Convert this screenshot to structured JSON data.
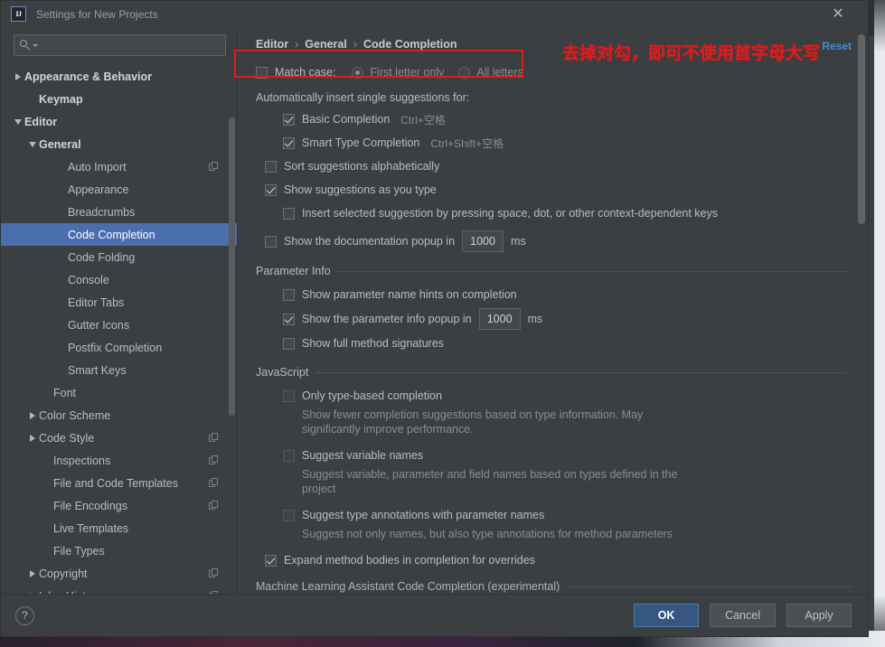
{
  "window": {
    "title": "Settings for New Projects",
    "logo_icon": "intellij-idea-logo",
    "close_icon": "close-icon"
  },
  "search": {
    "value": "",
    "placeholder": "",
    "icon": "search-icon",
    "caret_icon": "chevron-down-icon"
  },
  "sidebar": {
    "scrollbar_icon": "vertical-scrollbar",
    "items": [
      {
        "label": "Appearance & Behavior",
        "indent": 0,
        "twisty": "right",
        "bold": true,
        "selected": false,
        "copy_icon": false
      },
      {
        "label": "Keymap",
        "indent": 1,
        "twisty": "none",
        "bold": true,
        "selected": false,
        "copy_icon": false
      },
      {
        "label": "Editor",
        "indent": 0,
        "twisty": "down",
        "bold": true,
        "selected": false,
        "copy_icon": false
      },
      {
        "label": "General",
        "indent": 1,
        "twisty": "down",
        "bold": true,
        "selected": false,
        "copy_icon": false
      },
      {
        "label": "Auto Import",
        "indent": 3,
        "twisty": "none",
        "bold": false,
        "selected": false,
        "copy_icon": true
      },
      {
        "label": "Appearance",
        "indent": 3,
        "twisty": "none",
        "bold": false,
        "selected": false,
        "copy_icon": false
      },
      {
        "label": "Breadcrumbs",
        "indent": 3,
        "twisty": "none",
        "bold": false,
        "selected": false,
        "copy_icon": false
      },
      {
        "label": "Code Completion",
        "indent": 3,
        "twisty": "none",
        "bold": false,
        "selected": true,
        "copy_icon": false
      },
      {
        "label": "Code Folding",
        "indent": 3,
        "twisty": "none",
        "bold": false,
        "selected": false,
        "copy_icon": false
      },
      {
        "label": "Console",
        "indent": 3,
        "twisty": "none",
        "bold": false,
        "selected": false,
        "copy_icon": false
      },
      {
        "label": "Editor Tabs",
        "indent": 3,
        "twisty": "none",
        "bold": false,
        "selected": false,
        "copy_icon": false
      },
      {
        "label": "Gutter Icons",
        "indent": 3,
        "twisty": "none",
        "bold": false,
        "selected": false,
        "copy_icon": false
      },
      {
        "label": "Postfix Completion",
        "indent": 3,
        "twisty": "none",
        "bold": false,
        "selected": false,
        "copy_icon": false
      },
      {
        "label": "Smart Keys",
        "indent": 3,
        "twisty": "none",
        "bold": false,
        "selected": false,
        "copy_icon": false
      },
      {
        "label": "Font",
        "indent": 2,
        "twisty": "none",
        "bold": false,
        "selected": false,
        "copy_icon": false
      },
      {
        "label": "Color Scheme",
        "indent": 1,
        "twisty": "right",
        "bold": false,
        "selected": false,
        "copy_icon": false
      },
      {
        "label": "Code Style",
        "indent": 1,
        "twisty": "right",
        "bold": false,
        "selected": false,
        "copy_icon": true
      },
      {
        "label": "Inspections",
        "indent": 2,
        "twisty": "none",
        "bold": false,
        "selected": false,
        "copy_icon": true
      },
      {
        "label": "File and Code Templates",
        "indent": 2,
        "twisty": "none",
        "bold": false,
        "selected": false,
        "copy_icon": true
      },
      {
        "label": "File Encodings",
        "indent": 2,
        "twisty": "none",
        "bold": false,
        "selected": false,
        "copy_icon": true
      },
      {
        "label": "Live Templates",
        "indent": 2,
        "twisty": "none",
        "bold": false,
        "selected": false,
        "copy_icon": false
      },
      {
        "label": "File Types",
        "indent": 2,
        "twisty": "none",
        "bold": false,
        "selected": false,
        "copy_icon": false
      },
      {
        "label": "Copyright",
        "indent": 1,
        "twisty": "right",
        "bold": false,
        "selected": false,
        "copy_icon": true
      },
      {
        "label": "Inlay Hints",
        "indent": 1,
        "twisty": "right",
        "bold": false,
        "selected": false,
        "copy_icon": true
      }
    ]
  },
  "content": {
    "breadcrumb": [
      "Editor",
      "General",
      "Code Completion"
    ],
    "breadcrumb_separator": "›",
    "reset_label": "Reset",
    "match_case": {
      "label": "Match case:",
      "checked": false,
      "options": [
        {
          "label": "First letter only",
          "selected": true
        },
        {
          "label": "All letters",
          "selected": false
        }
      ]
    },
    "auto_insert_group_label": "Automatically insert single suggestions for:",
    "auto_insert_items": [
      {
        "label": "Basic Completion",
        "shortcut": "Ctrl+空格",
        "checked": true
      },
      {
        "label": "Smart Type Completion",
        "shortcut": "Ctrl+Shift+空格",
        "checked": true
      }
    ],
    "general_items": [
      {
        "label": "Sort suggestions alphabetically",
        "checked": false,
        "indent": 0
      },
      {
        "label": "Show suggestions as you type",
        "checked": true,
        "indent": 0
      },
      {
        "label": "Insert selected suggestion by pressing space, dot, or other context-dependent keys",
        "checked": false,
        "indent": 1
      }
    ],
    "doc_popup": {
      "label_before": "Show the documentation popup in",
      "value": "1000",
      "label_after": "ms",
      "checked": false
    },
    "parameter_info": {
      "section_title": "Parameter Info",
      "hints": {
        "label": "Show parameter name hints on completion",
        "checked": false
      },
      "popup": {
        "label_before": "Show the parameter info popup in",
        "value": "1000",
        "label_after": "ms",
        "checked": true
      },
      "signatures": {
        "label": "Show full method signatures",
        "checked": false
      }
    },
    "javascript": {
      "section_title": "JavaScript",
      "items": [
        {
          "label": "Only type-based completion",
          "checked": false,
          "description": "Show fewer completion suggestions based on type information. May significantly improve performance."
        },
        {
          "label": "Suggest variable names",
          "checked": false,
          "description": "Suggest variable, parameter and field names based on types defined in the project"
        },
        {
          "label": "Suggest type annotations with parameter names",
          "checked": false,
          "description": "Suggest not only names, but also type annotations for method parameters"
        }
      ],
      "expand_bodies": {
        "label": "Expand method bodies in completion for overrides",
        "checked": true
      }
    },
    "cut_section_title": "Machine Learning Assistant Code Completion (experimental)"
  },
  "annotation": {
    "text": "去掉对勾，即可不使用首字母大写",
    "color": "#e01b1b"
  },
  "footer": {
    "help_label": "?",
    "ok_label": "OK",
    "cancel_label": "Cancel",
    "apply_label": "Apply"
  },
  "colors": {
    "accent_selection": "#4b6eaf",
    "primary_button": "#365880",
    "link": "#4a88d6",
    "annotation_red": "#e01b1b",
    "panel_bg": "#3c3f41"
  }
}
